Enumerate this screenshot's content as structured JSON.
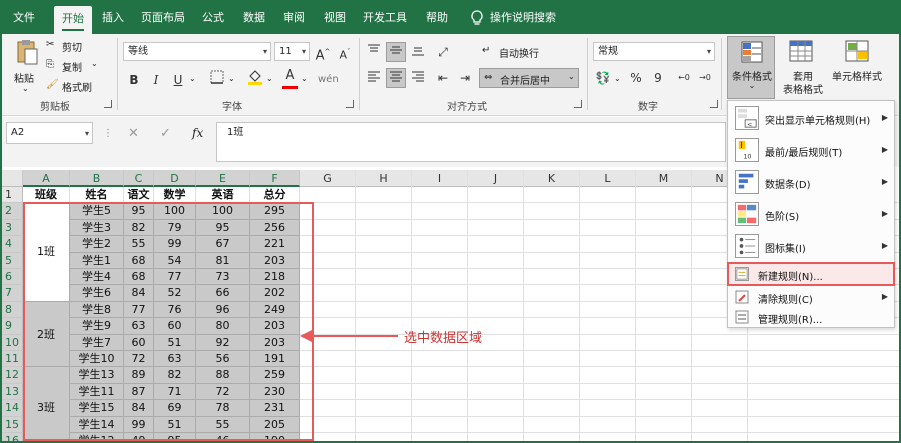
{
  "tabs": [
    {
      "label": "文件",
      "active": false
    },
    {
      "label": "开始",
      "active": true
    },
    {
      "label": "插入",
      "active": false
    },
    {
      "label": "页面布局",
      "active": false
    },
    {
      "label": "公式",
      "active": false
    },
    {
      "label": "数据",
      "active": false
    },
    {
      "label": "审阅",
      "active": false
    },
    {
      "label": "视图",
      "active": false
    },
    {
      "label": "开发工具",
      "active": false
    },
    {
      "label": "帮助",
      "active": false
    }
  ],
  "tell_me": "操作说明搜索",
  "ribbon": {
    "clipboard": {
      "paste": "粘贴",
      "cut": "剪切",
      "copy": "复制",
      "format_painter": "格式刷",
      "label": "剪贴板"
    },
    "font": {
      "name": "等线",
      "size": "11",
      "bold": "B",
      "italic": "I",
      "underline": "U",
      "label": "字体",
      "grow": "A",
      "shrink": "A",
      "font_color": "A"
    },
    "alignment": {
      "wrap": "自动换行",
      "merge": "合并后居中",
      "label": "对齐方式"
    },
    "number": {
      "format": "常规",
      "percent": "%",
      "comma": "9",
      "label": "数字"
    },
    "styles": {
      "conditional": "条件格式",
      "table_format_1": "套用",
      "table_format_2": "表格格式",
      "cell_style": "单元格样式"
    }
  },
  "formula_bar": {
    "name_box": "A2",
    "fx": "fx",
    "value": "1班"
  },
  "columns": [
    "A",
    "B",
    "C",
    "D",
    "E",
    "F",
    "G",
    "H",
    "I",
    "J",
    "K",
    "L",
    "M",
    "N"
  ],
  "row_numbers": [
    "1",
    "2",
    "3",
    "4",
    "5",
    "6",
    "7",
    "8",
    "9",
    "10",
    "11",
    "12",
    "13",
    "14",
    "15",
    "16"
  ],
  "headers": [
    "班级",
    "姓名",
    "语文",
    "数学",
    "英语",
    "总分"
  ],
  "groups": [
    {
      "label": "1班",
      "start": 0,
      "count": 6
    },
    {
      "label": "2班",
      "start": 6,
      "count": 4
    },
    {
      "label": "3班",
      "start": 10,
      "count": 5
    }
  ],
  "rows": [
    [
      "学生5",
      "95",
      "100",
      "100",
      "295"
    ],
    [
      "学生3",
      "82",
      "79",
      "95",
      "256"
    ],
    [
      "学生2",
      "55",
      "99",
      "67",
      "221"
    ],
    [
      "学生1",
      "68",
      "54",
      "81",
      "203"
    ],
    [
      "学生4",
      "68",
      "77",
      "73",
      "218"
    ],
    [
      "学生6",
      "84",
      "52",
      "66",
      "202"
    ],
    [
      "学生8",
      "77",
      "76",
      "96",
      "249"
    ],
    [
      "学生9",
      "63",
      "60",
      "80",
      "203"
    ],
    [
      "学生7",
      "60",
      "51",
      "92",
      "203"
    ],
    [
      "学生10",
      "72",
      "63",
      "56",
      "191"
    ],
    [
      "学生13",
      "89",
      "82",
      "88",
      "259"
    ],
    [
      "学生11",
      "87",
      "71",
      "72",
      "230"
    ],
    [
      "学生15",
      "84",
      "69",
      "78",
      "231"
    ],
    [
      "学生14",
      "99",
      "51",
      "55",
      "205"
    ],
    [
      "学生12",
      "49",
      "95",
      "46",
      "190"
    ]
  ],
  "menu": [
    {
      "label": "突出显示单元格规则(H)",
      "submenu": true
    },
    {
      "label": "最前/最后规则(T)",
      "submenu": true
    },
    {
      "label": "数据条(D)",
      "submenu": true
    },
    {
      "label": "色阶(S)",
      "submenu": true
    },
    {
      "label": "图标集(I)",
      "submenu": true
    },
    {
      "label": "新建规则(N)...",
      "submenu": false,
      "highlighted": true
    },
    {
      "label": "清除规则(C)",
      "submenu": true
    },
    {
      "label": "管理规则(R)...",
      "submenu": false
    }
  ],
  "annotation": "选中数据区域",
  "colors": {
    "accent": "#217346",
    "highlight": "#e65a5a",
    "selection": "#c9c9c9"
  }
}
